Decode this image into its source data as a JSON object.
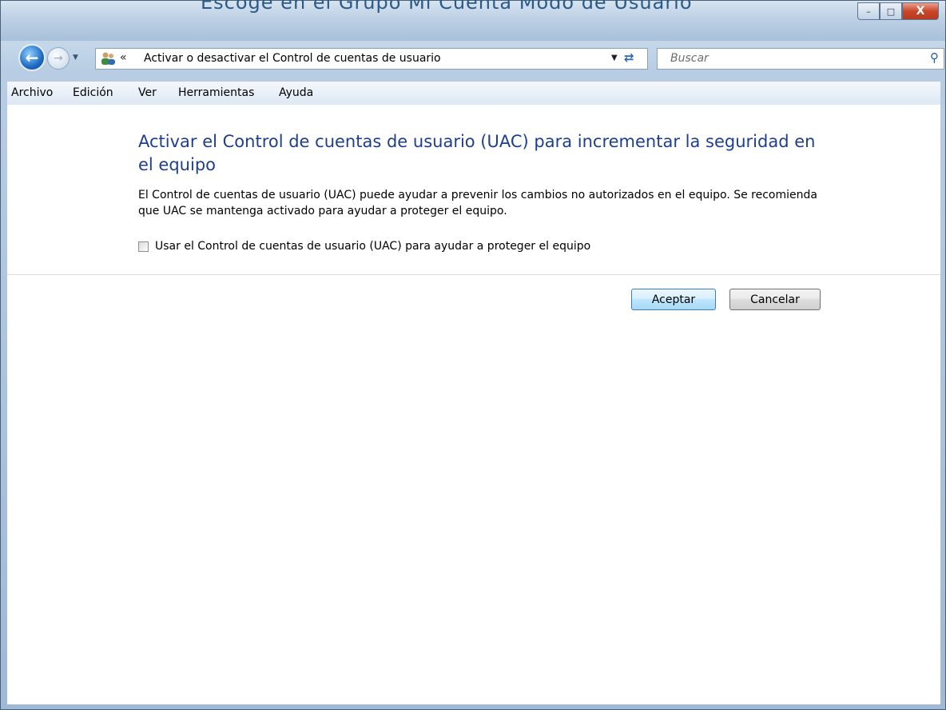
{
  "window": {
    "cropped_title": "Escoge en el Grupo Mi Cuenta Modo de Usuario",
    "controls": {
      "minimize": "–",
      "maximize": "□",
      "close": "X"
    }
  },
  "nav": {
    "back_icon": "back-arrow-icon",
    "forward_icon": "forward-arrow-icon",
    "address_prefix": "«",
    "address": "Activar o desactivar el Control de cuentas de usuario",
    "search_placeholder": "Buscar"
  },
  "menu": [
    "Archivo",
    "Edición",
    "Ver",
    "Herramientas",
    "Ayuda"
  ],
  "main": {
    "heading": "Activar el Control de cuentas de usuario (UAC) para incrementar la seguridad en el equipo",
    "description": "El Control de cuentas de usuario (UAC) puede ayudar a prevenir los cambios no autorizados en el equipo. Se recomienda que UAC se mantenga activado para ayudar a proteger el equipo.",
    "checkbox_label": "Usar el Control de cuentas de usuario (UAC) para ayudar a proteger el equipo",
    "checkbox_checked": false
  },
  "buttons": {
    "ok": "Aceptar",
    "cancel": "Cancelar"
  },
  "colors": {
    "heading": "#1e3f8e",
    "accent": "#3c7fb1"
  }
}
